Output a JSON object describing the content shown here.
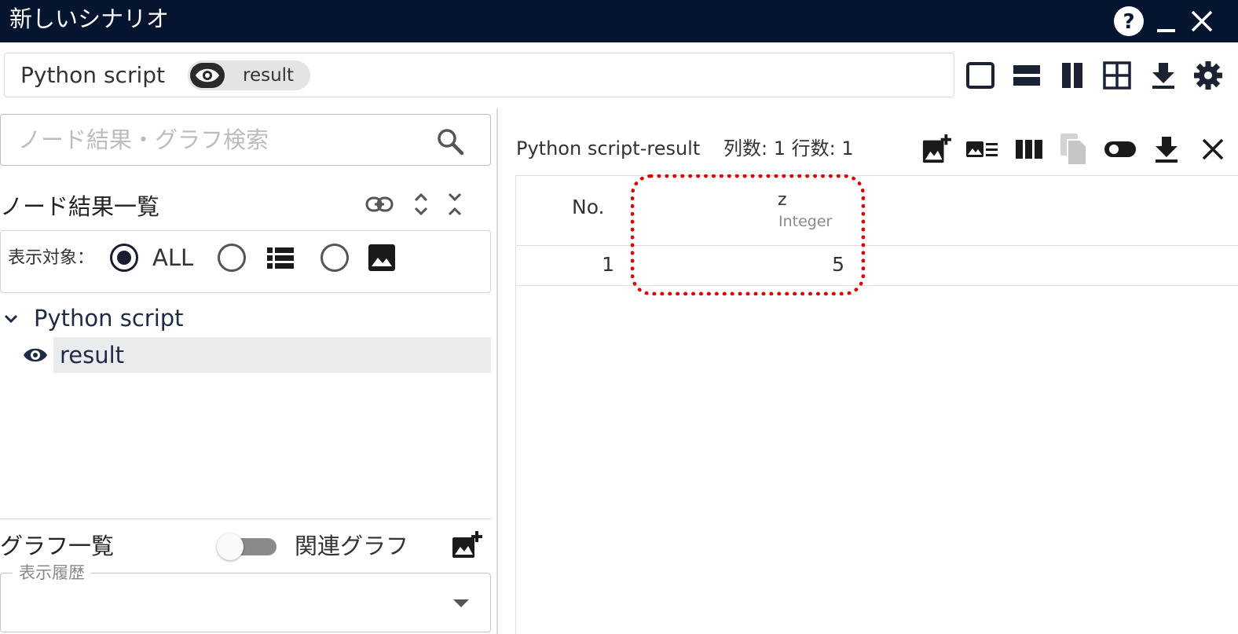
{
  "window": {
    "title": "新しいシナリオ",
    "controls": [
      "help-icon",
      "minimize-icon",
      "close-icon"
    ]
  },
  "breadcrumb": {
    "node": "Python script",
    "chip_label": "result",
    "chip_icon": "eye-icon"
  },
  "layout_toolbar": {
    "icons": [
      "single-pane-icon",
      "horizontal-split-icon",
      "vertical-split-icon",
      "grid-split-icon",
      "download-icon",
      "settings-icon"
    ]
  },
  "search": {
    "placeholder": "ノード結果・グラフ検索",
    "value": ""
  },
  "node_results": {
    "title": "ノード結果一覧",
    "header_icons": [
      "link-icon",
      "expand-all-icon",
      "collapse-all-icon"
    ],
    "filter": {
      "label": "表示対象：",
      "options": [
        {
          "label": "ALL",
          "selected": true
        },
        {
          "icon": "table-list-icon",
          "selected": false
        },
        {
          "icon": "image-icon",
          "selected": false
        }
      ]
    },
    "tree": {
      "parent": "Python script",
      "child": "result"
    }
  },
  "graph_list": {
    "title": "グラフ一覧",
    "toggle_label": "関連グラフ",
    "toggle_on": false,
    "history_label": "表示履歴",
    "history_value": ""
  },
  "result_panel": {
    "title": "Python script-result",
    "counts": "列数: 1 行数: 1",
    "icons": [
      "add-chart-icon",
      "row-detail-icon",
      "columns-icon",
      "copy-icon",
      "toggle-icon",
      "download-icon",
      "close-icon"
    ],
    "table": {
      "columns": [
        {
          "name": "No.",
          "type": ""
        },
        {
          "name": "z",
          "type": "Integer"
        }
      ],
      "rows": [
        {
          "no": "1",
          "z": "5"
        }
      ]
    }
  },
  "colors": {
    "titlebar_bg": "#051530",
    "highlight": "#e00000",
    "selected_row_bg": "#eaebed"
  }
}
